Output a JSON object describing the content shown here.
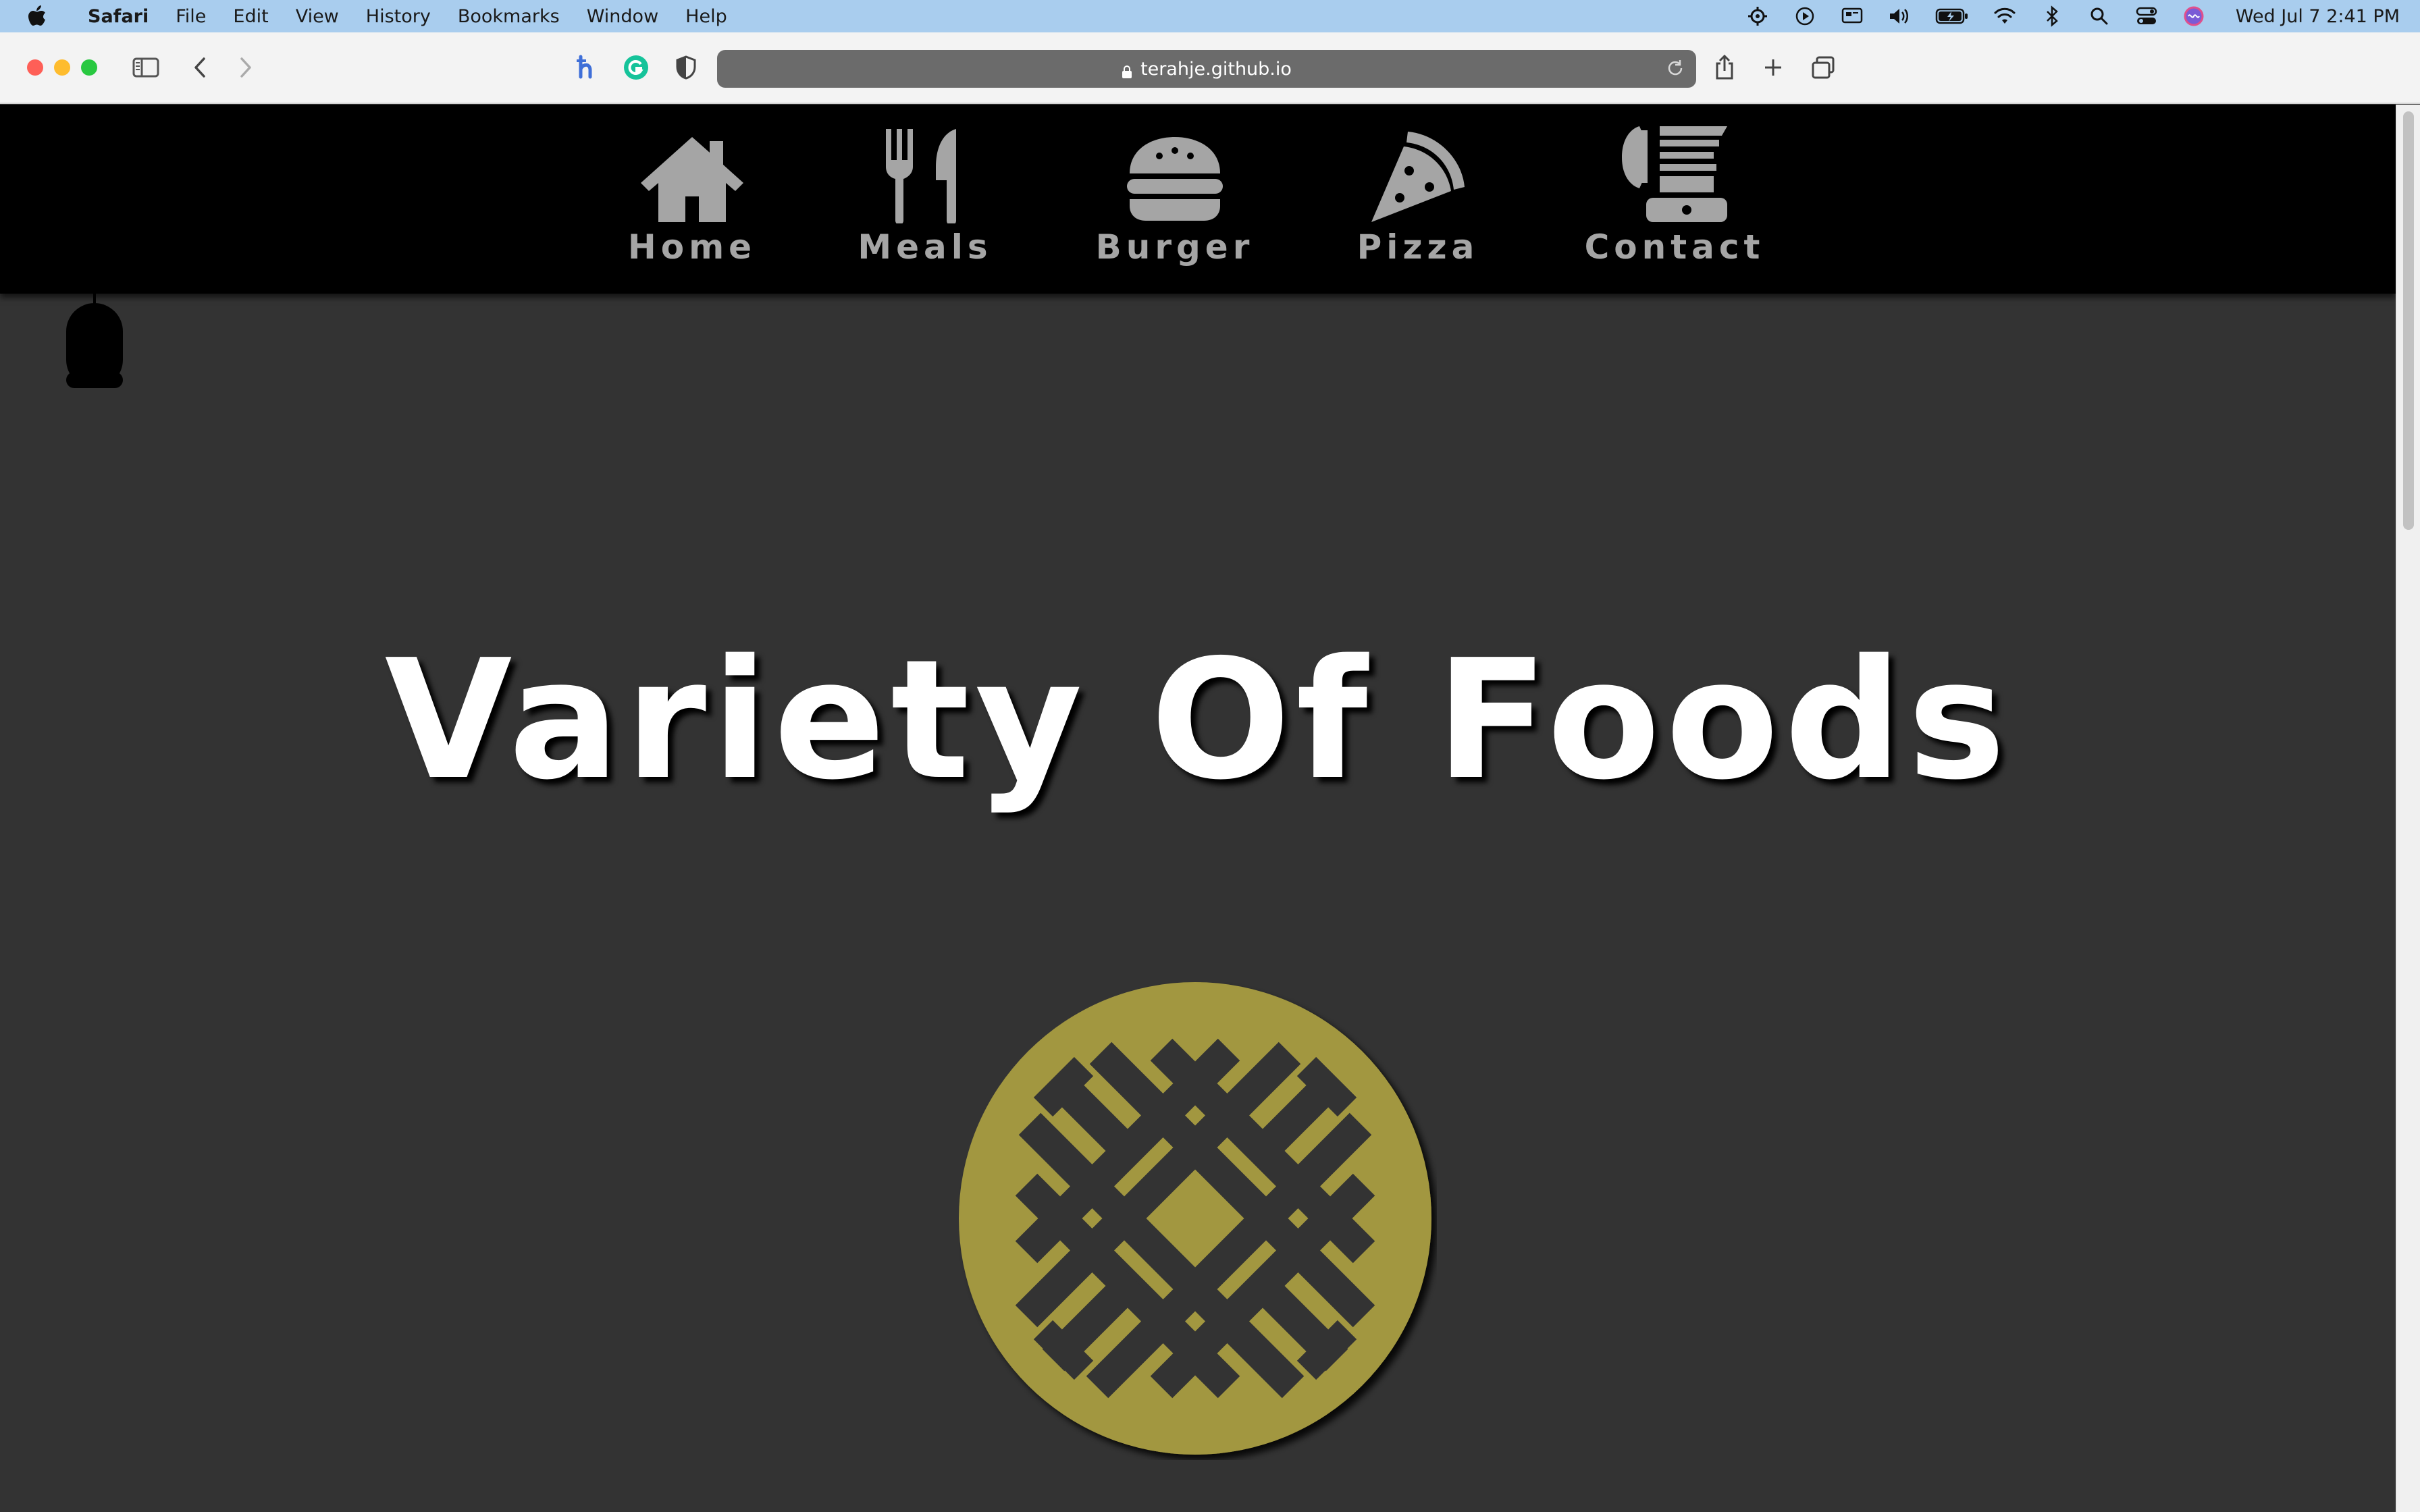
{
  "menubar": {
    "app_name": "Safari",
    "items": [
      "File",
      "Edit",
      "View",
      "History",
      "Bookmarks",
      "Window",
      "Help"
    ],
    "clock": "Wed Jul 7  2:41 PM"
  },
  "browser": {
    "url": "terahje.github.io"
  },
  "nav": {
    "items": [
      {
        "label": "Home",
        "icon": "home-icon"
      },
      {
        "label": "Meals",
        "icon": "fork-knife-icon"
      },
      {
        "label": "Burger",
        "icon": "burger-icon"
      },
      {
        "label": "Pizza",
        "icon": "pizza-slice-icon"
      },
      {
        "label": "Contact",
        "icon": "fax-phone-icon"
      }
    ]
  },
  "hero": {
    "title": "Variety Of Foods",
    "logo_icon": "waffle-icon"
  },
  "colors": {
    "page_bg": "#333333",
    "nav_bg": "#000000",
    "nav_text": "#a5a5a5",
    "waffle": "#a29741",
    "title": "#ffffff"
  }
}
